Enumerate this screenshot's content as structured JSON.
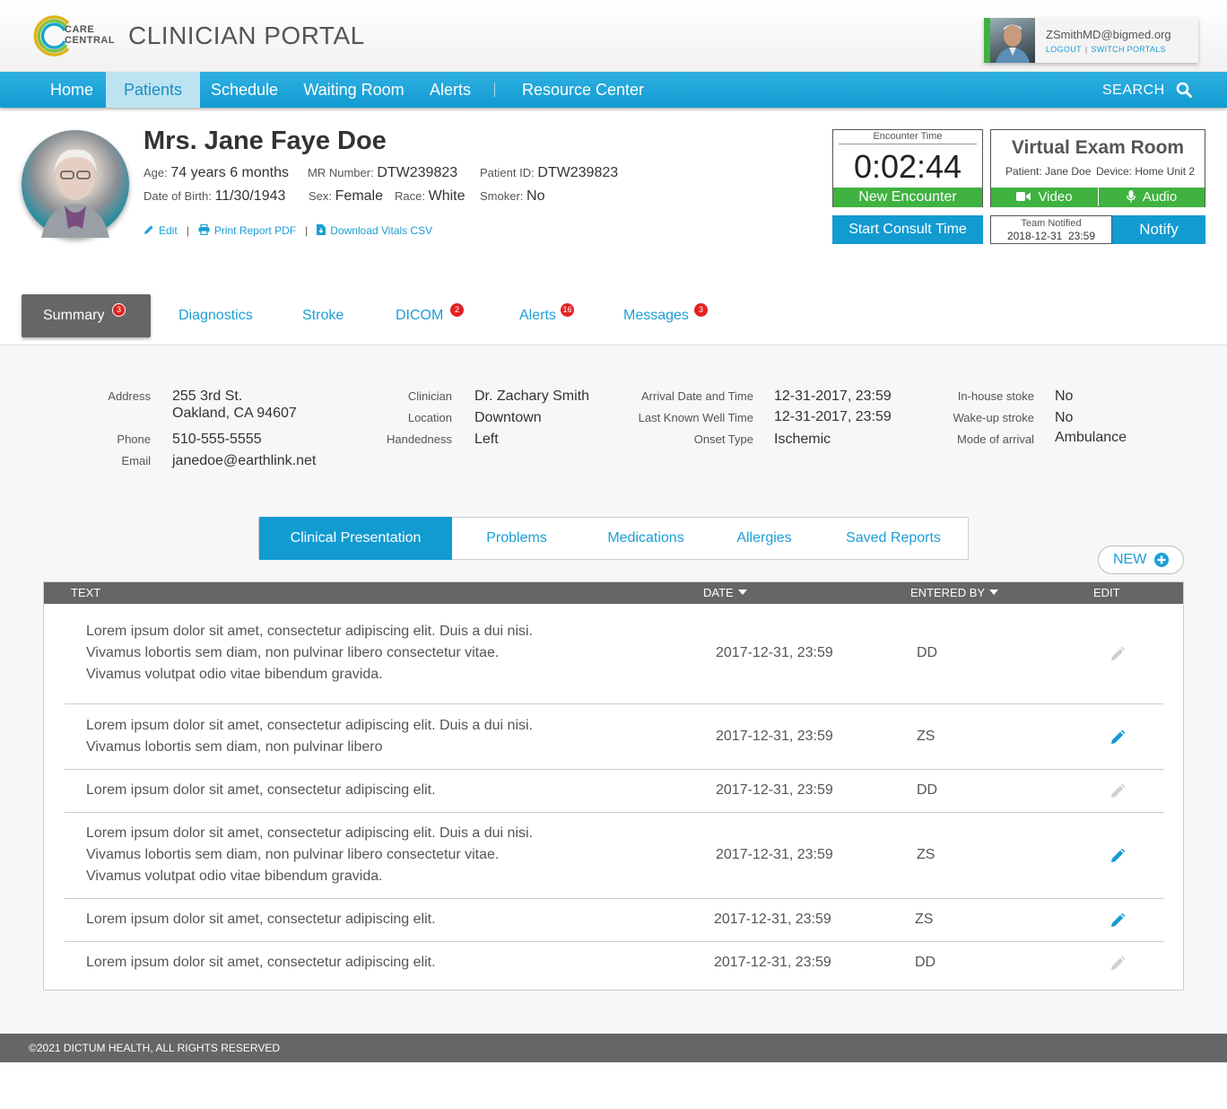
{
  "header": {
    "logo_line1": "CARE",
    "logo_line2": "CENTRAL",
    "portal_title": "CLINICIAN PORTAL",
    "user": {
      "email": "ZSmithMD@bigmed.org",
      "logout": "LOGOUT",
      "separator": "|",
      "switch_portals": "SWITCH PORTALS"
    }
  },
  "nav": {
    "items": [
      "Home",
      "Patients",
      "Schedule",
      "Waiting Room",
      "Alerts",
      "Resource Center"
    ],
    "active": "Patients",
    "search_label": "SEARCH"
  },
  "patient": {
    "name": "Mrs. Jane Faye Doe",
    "age_label": "Age:",
    "age": "74 years 6 months",
    "mrn_label": "MR Number:",
    "mrn": "DTW239823",
    "pid_label": "Patient ID:",
    "pid": "DTW239823",
    "dob_label": "Date of Birth:",
    "dob": "11/30/1943",
    "sex_label": "Sex:",
    "sex": "Female",
    "race_label": "Race:",
    "race": "White",
    "smoker_label": "Smoker:",
    "smoker": "No",
    "actions": {
      "edit": "Edit",
      "print": "Print Report PDF",
      "download": "Download Vitals CSV",
      "sep": "|"
    }
  },
  "encounter": {
    "label": "Encounter Time",
    "time": "0:02:44",
    "new_encounter": "New Encounter",
    "start_consult": "Start Consult Time"
  },
  "virtual_exam": {
    "title": "Virtual Exam Room",
    "patient": "Patient: Jane Doe",
    "device": "Device: Home Unit 2",
    "video": "Video",
    "audio": "Audio",
    "team_label": "Team Notified",
    "team_time": "2018-12-31  23:59",
    "notify": "Notify"
  },
  "tabs": [
    {
      "label": "Summary",
      "badge": "3",
      "active": true
    },
    {
      "label": "Diagnostics",
      "badge": ""
    },
    {
      "label": "Stroke",
      "badge": ""
    },
    {
      "label": "DICOM",
      "badge": "2"
    },
    {
      "label": "Alerts",
      "badge": "16"
    },
    {
      "label": "Messages",
      "badge": "3"
    }
  ],
  "details": {
    "address_label": "Address",
    "address_line1": "255 3rd St.",
    "address_line2": "Oakland, CA 94607",
    "phone_label": "Phone",
    "phone": "510-555-5555",
    "email_label": "Email",
    "email": "janedoe@earthlink.net",
    "clinician_label": "Clinician",
    "clinician": "Dr. Zachary Smith",
    "location_label": "Location",
    "location": "Downtown",
    "handedness_label": "Handedness",
    "handedness": "Left",
    "arrival_label": "Arrival Date and Time",
    "arrival": "12-31-2017, 23:59",
    "lkw_label": "Last Known Well Time",
    "lkw": "12-31-2017, 23:59",
    "onset_label": "Onset Type",
    "onset": "Ischemic",
    "inhouse_label": "In-house stoke",
    "inhouse": "No",
    "wakeup_label": "Wake-up stroke",
    "wakeup": "No",
    "arrival_mode_label": "Mode of arrival",
    "arrival_mode": "Ambulance"
  },
  "subtabs": {
    "items": [
      "Clinical Presentation",
      "Problems",
      "Medications",
      "Allergies",
      "Saved Reports"
    ],
    "active": "Clinical Presentation",
    "new_button": "NEW"
  },
  "table": {
    "headers": {
      "text": "TEXT",
      "date": "DATE",
      "entered_by": "ENTERED BY",
      "edit": "EDIT"
    },
    "rows": [
      {
        "lines": [
          "Lorem ipsum dolor sit amet, consectetur adipiscing elit. Duis a dui nisi.",
          "Vivamus lobortis sem diam, non pulvinar libero consectetur vitae.",
          "Vivamus volutpat odio vitae bibendum gravida."
        ],
        "date": "2017-12-31, 23:59",
        "by": "DD",
        "editable": false
      },
      {
        "lines": [
          "Lorem ipsum dolor sit amet, consectetur adipiscing elit. Duis a dui nisi.",
          "Vivamus lobortis sem diam, non pulvinar libero"
        ],
        "date": "2017-12-31, 23:59",
        "by": "ZS",
        "editable": true
      },
      {
        "lines": [
          "Lorem ipsum dolor sit amet, consectetur adipiscing elit."
        ],
        "date": "2017-12-31, 23:59",
        "by": "DD",
        "editable": false
      },
      {
        "lines": [
          "Lorem ipsum dolor sit amet, consectetur adipiscing elit. Duis a dui nisi.",
          "Vivamus lobortis sem diam, non pulvinar libero consectetur vitae.",
          "Vivamus volutpat odio vitae bibendum gravida."
        ],
        "date": "2017-12-31, 23:59",
        "by": "ZS",
        "editable": true
      },
      {
        "lines": [
          "Lorem ipsum dolor sit amet, consectetur adipiscing elit."
        ],
        "date": "2017-12-31, 23:59",
        "by": "ZS",
        "editable": true
      },
      {
        "lines": [
          "Lorem ipsum dolor sit amet, consectetur adipiscing elit."
        ],
        "date": "2017-12-31, 23:59",
        "by": "DD",
        "editable": false
      }
    ]
  },
  "footer": {
    "text": "©2021 DICTUM HEALTH, ALL RIGHTS RESERVED"
  },
  "colors": {
    "brand_blue": "#129bd1",
    "green": "#3fb23f",
    "badge_red": "#e32222",
    "header_gray": "#666666"
  }
}
